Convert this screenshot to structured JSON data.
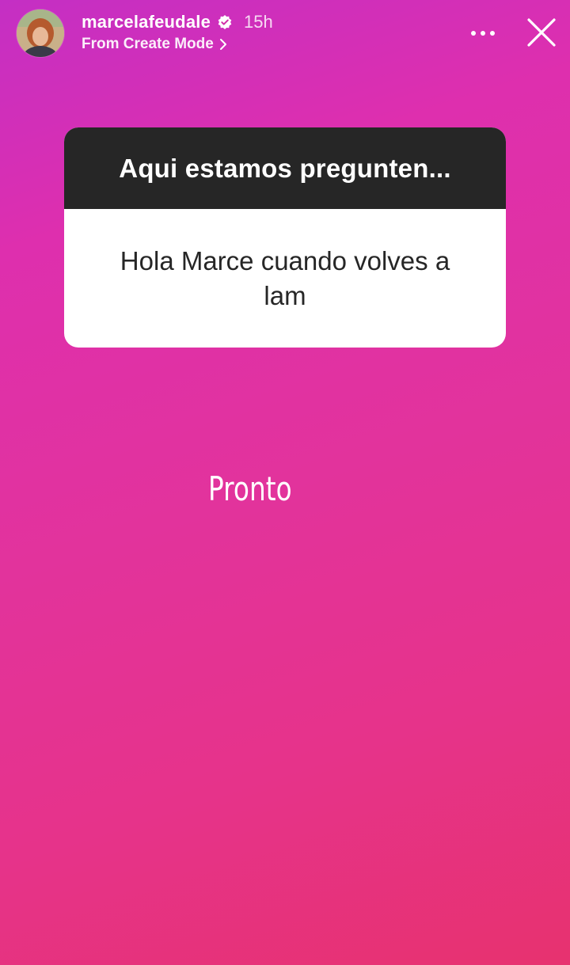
{
  "header": {
    "username": "marcelafeudale",
    "verified": true,
    "time_ago": "15h",
    "subtitle": "From Create Mode",
    "icons": {
      "avatar": "profile-avatar",
      "verified": "verified-badge-icon",
      "subtitle_chevron": "chevron-right-icon",
      "more": "more-options-icon",
      "close": "close-icon"
    }
  },
  "question_sticker": {
    "prompt": "Aqui estamos pregunten...",
    "answer": "Hola Marce cuando volves a lam"
  },
  "reply": {
    "text": "Pronto"
  },
  "colors": {
    "gradient_start": "#c42fc4",
    "gradient_end": "#e7326f",
    "card_header": "#262626",
    "card_body": "#ffffff"
  }
}
